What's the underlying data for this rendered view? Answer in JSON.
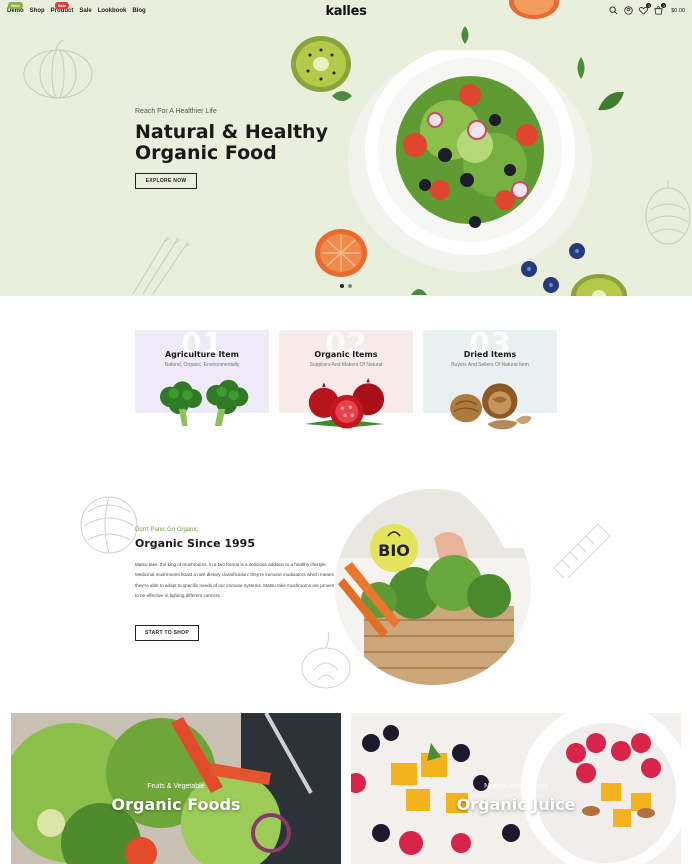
{
  "header": {
    "nav": [
      {
        "label": "Demo",
        "badge": "New",
        "badge_color": "#8cb53f"
      },
      {
        "label": "Shop",
        "badge": "",
        "badge_color": ""
      },
      {
        "label": "Product",
        "badge": "Sale",
        "badge_color": "#e63b3b"
      },
      {
        "label": "Sale",
        "badge": "",
        "badge_color": ""
      },
      {
        "label": "Lookbook",
        "badge": "",
        "badge_color": ""
      },
      {
        "label": "Blog",
        "badge": "",
        "badge_color": ""
      }
    ],
    "logo": "kalles",
    "wishlist_count": "0",
    "cart_count": "0",
    "cart_total": "$0.00"
  },
  "hero": {
    "eyebrow": "Reach For A Healthier Life",
    "title": "Natural & Healthy Organic Food",
    "button": "EXPLORE NOW",
    "background": "#eaeedc"
  },
  "categories": [
    {
      "number": "01",
      "title": "Agriculture Item",
      "subtitle": "Natural, Organic, Environmentally",
      "background": "#eeeaf7"
    },
    {
      "number": "02",
      "title": "Organic Items",
      "subtitle": "Suppliers And Makers Of Natural",
      "background": "#f7ebe9"
    },
    {
      "number": "03",
      "title": "Dried Items",
      "subtitle": "Buyers And Sellers Of Natural Item",
      "background": "#e8f1f0"
    }
  ],
  "about": {
    "eyebrow": "Don't Panic Go Organic",
    "title": "Organic Since 1995",
    "body": "Matsu take, the king of mushrooms, in a two format is a delicious addition to a healthy lifestyle. Medicinal mushrooms boast a rare dietary classification: they're immune modulators which means they're able to adapt to specific needs of our immune systems. Matsu take mushrooms are proven to be effective in fighting different cancers.",
    "button": "START TO SHOP",
    "bio_label": "BIO"
  },
  "banners": [
    {
      "subtitle": "Fruits & Vegetable",
      "title": "Organic Foods"
    },
    {
      "subtitle": "Newest Arrival Items",
      "title": "Organic Juice"
    }
  ]
}
